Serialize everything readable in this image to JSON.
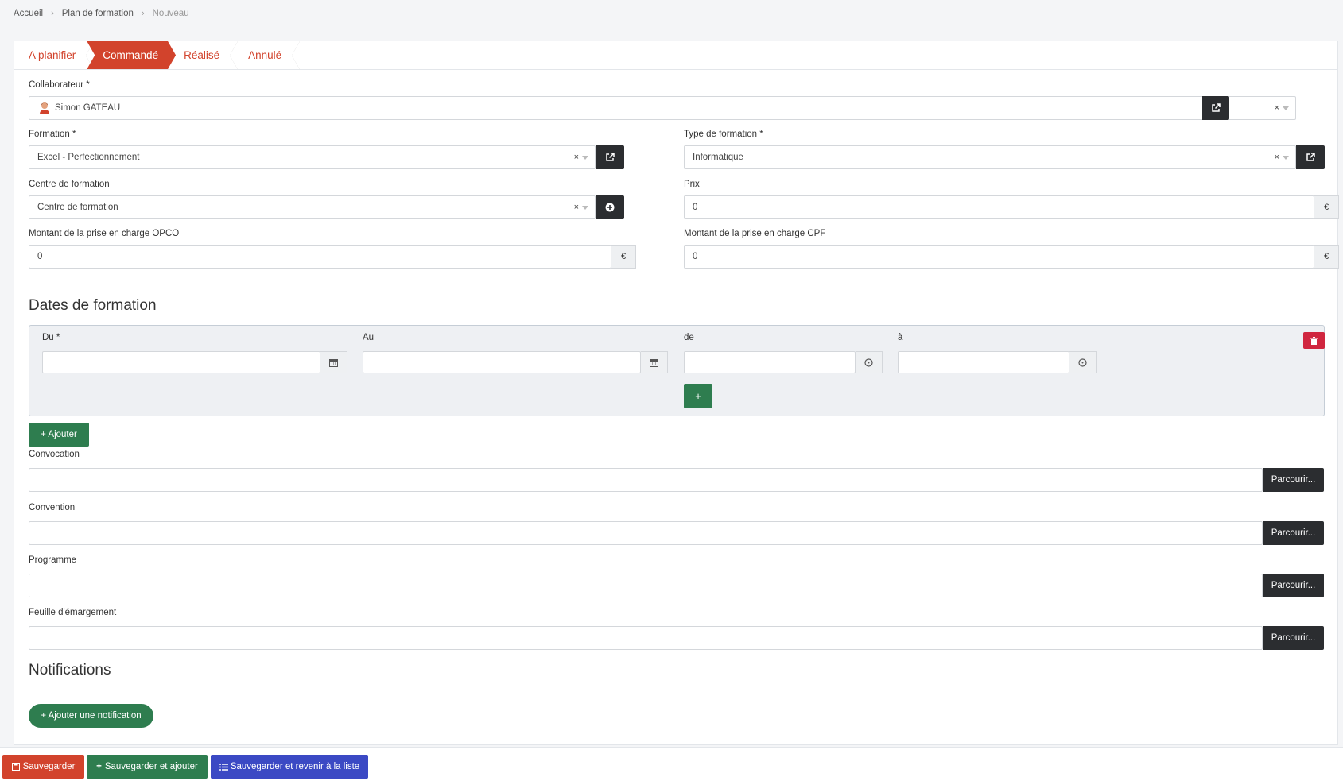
{
  "breadcrumb": [
    "Accueil",
    "Plan de formation",
    "Nouveau"
  ],
  "steps": [
    "A planifier",
    "Commandé",
    "Réalisé",
    "Annulé"
  ],
  "fields": {
    "collaborateur": {
      "label": "Collaborateur *",
      "value": "Simon GATEAU"
    },
    "formation": {
      "label": "Formation *",
      "value": "Excel - Perfectionnement"
    },
    "type_formation": {
      "label": "Type de formation *",
      "value": "Informatique"
    },
    "centre": {
      "label": "Centre de formation",
      "placeholder": "Centre de formation"
    },
    "prix": {
      "label": "Prix",
      "value": "0",
      "unit": "€"
    },
    "opco": {
      "label": "Montant de la prise en charge OPCO",
      "value": "0",
      "unit": "€"
    },
    "cpf": {
      "label": "Montant de la prise en charge CPF",
      "value": "0",
      "unit": "€"
    }
  },
  "dates": {
    "title": "Dates de formation",
    "du_label": "Du *",
    "au_label": "Au",
    "de_label": "de",
    "a_label": "à",
    "add_row": "+",
    "add_label": "+ Ajouter"
  },
  "files": [
    {
      "label": "Convocation",
      "button": "Parcourir..."
    },
    {
      "label": "Convention",
      "button": "Parcourir..."
    },
    {
      "label": "Programme",
      "button": "Parcourir..."
    },
    {
      "label": "Feuille d'émargement",
      "button": "Parcourir..."
    }
  ],
  "notifications": {
    "title": "Notifications",
    "add_label": "+ Ajouter une notification"
  },
  "footer": {
    "save": "Sauvegarder",
    "save_add": "Sauvegarder et ajouter",
    "save_list": "Sauvegarder et revenir à la liste"
  },
  "colors": {
    "primary": "#d2432c",
    "success": "#2e7d4f",
    "dark": "#2b2d30",
    "blue": "#3b49c4",
    "danger": "#d0263f"
  }
}
